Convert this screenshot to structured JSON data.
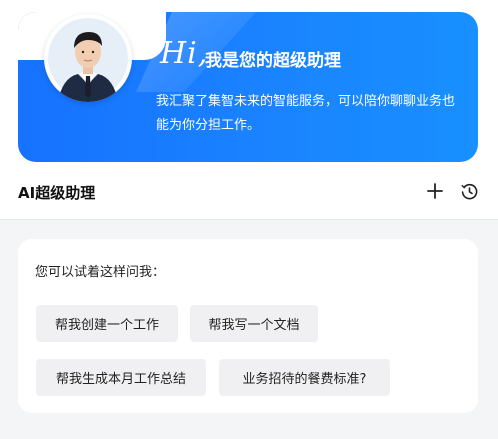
{
  "hero": {
    "greeting": "Hi,",
    "title": "我是您的超级助理",
    "description": "我汇聚了集智未来的智能服务，可以陪你聊聊业务也能为你分担工作。"
  },
  "header": {
    "title": "AI超级助理",
    "new_icon": "plus-icon",
    "history_icon": "history-clock-icon"
  },
  "suggestions": {
    "label": "您可以试着这样问我：",
    "chips": [
      "帮我创建一个工作",
      "帮我写一个文档",
      "帮我生成本月工作总结",
      "业务招待的餐费标准?"
    ]
  },
  "colors": {
    "accent": "#1a83ff",
    "chip_bg": "#f0f0f2",
    "page_bg": "#f4f5f7"
  }
}
